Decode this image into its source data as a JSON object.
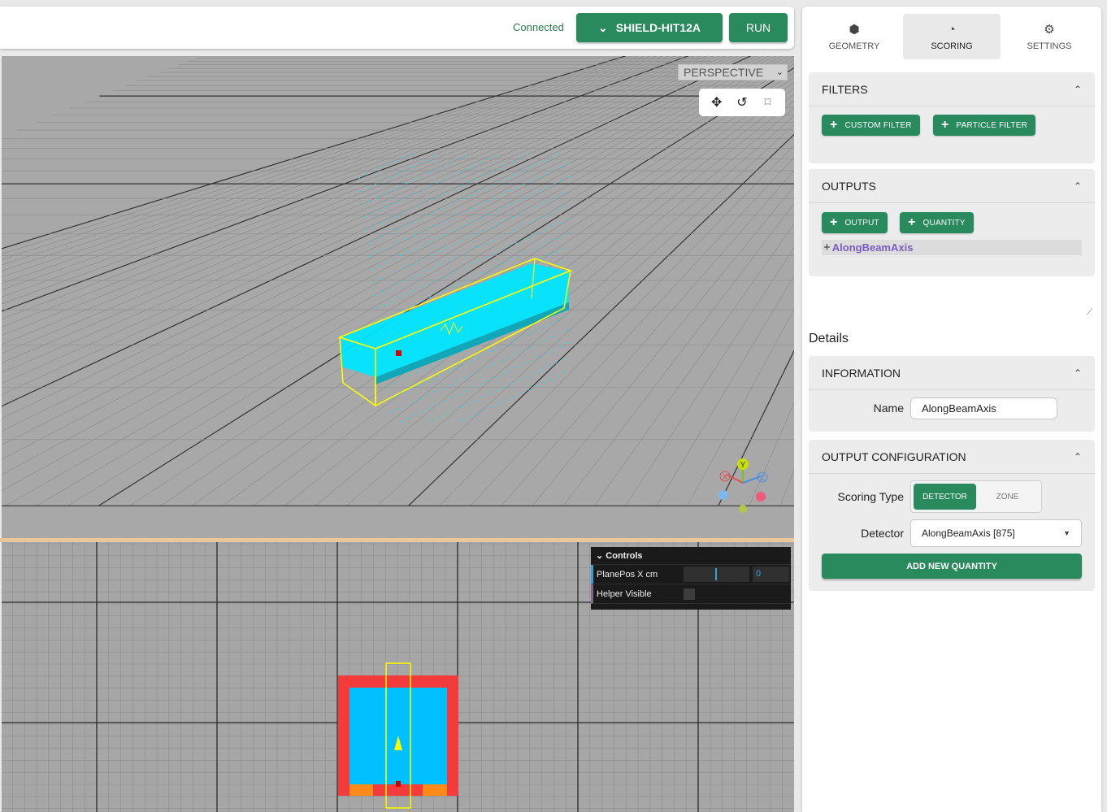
{
  "topbar": {
    "status": "Connected",
    "simulator_label": "SHIELD-HIT12A",
    "run_label": "RUN"
  },
  "viewport3d": {
    "camera_mode": "PERSPECTIVE",
    "tools": [
      "move-icon",
      "rotate-icon",
      "crop-icon"
    ],
    "axes": [
      "Y",
      "X",
      "Z"
    ]
  },
  "controls": {
    "title": "Controls",
    "rows": [
      {
        "label": "PlanePos X cm",
        "value": "0"
      },
      {
        "label": "Helper Visible"
      }
    ]
  },
  "tabs": [
    {
      "label": "GEOMETRY",
      "icon": "cube-icon",
      "active": false
    },
    {
      "label": "SCORING",
      "icon": "gauge-icon",
      "active": true
    },
    {
      "label": "SETTINGS",
      "icon": "gear-icon",
      "active": false
    }
  ],
  "filters": {
    "title": "FILTERS",
    "buttons": [
      "CUSTOM FILTER",
      "PARTICLE FILTER"
    ]
  },
  "outputs": {
    "title": "OUTPUTS",
    "buttons": [
      "OUTPUT",
      "QUANTITY"
    ],
    "items": [
      "AlongBeamAxis"
    ]
  },
  "details": {
    "title": "Details",
    "information": {
      "title": "INFORMATION",
      "name_label": "Name",
      "name_value": "AlongBeamAxis"
    },
    "output_config": {
      "title": "OUTPUT CONFIGURATION",
      "scoring_type_label": "Scoring Type",
      "scoring_options": [
        "DETECTOR",
        "ZONE"
      ],
      "detector_label": "Detector",
      "detector_value": "AlongBeamAxis [875]",
      "add_button": "ADD NEW QUANTITY"
    }
  },
  "colors": {
    "accent": "#288a5d",
    "tree_item": "#7a5cc2",
    "scoring_mesh": "#00e5ff",
    "bbox": "#ffff00",
    "shield": "#f43b3b",
    "body": "#00c0ff"
  }
}
